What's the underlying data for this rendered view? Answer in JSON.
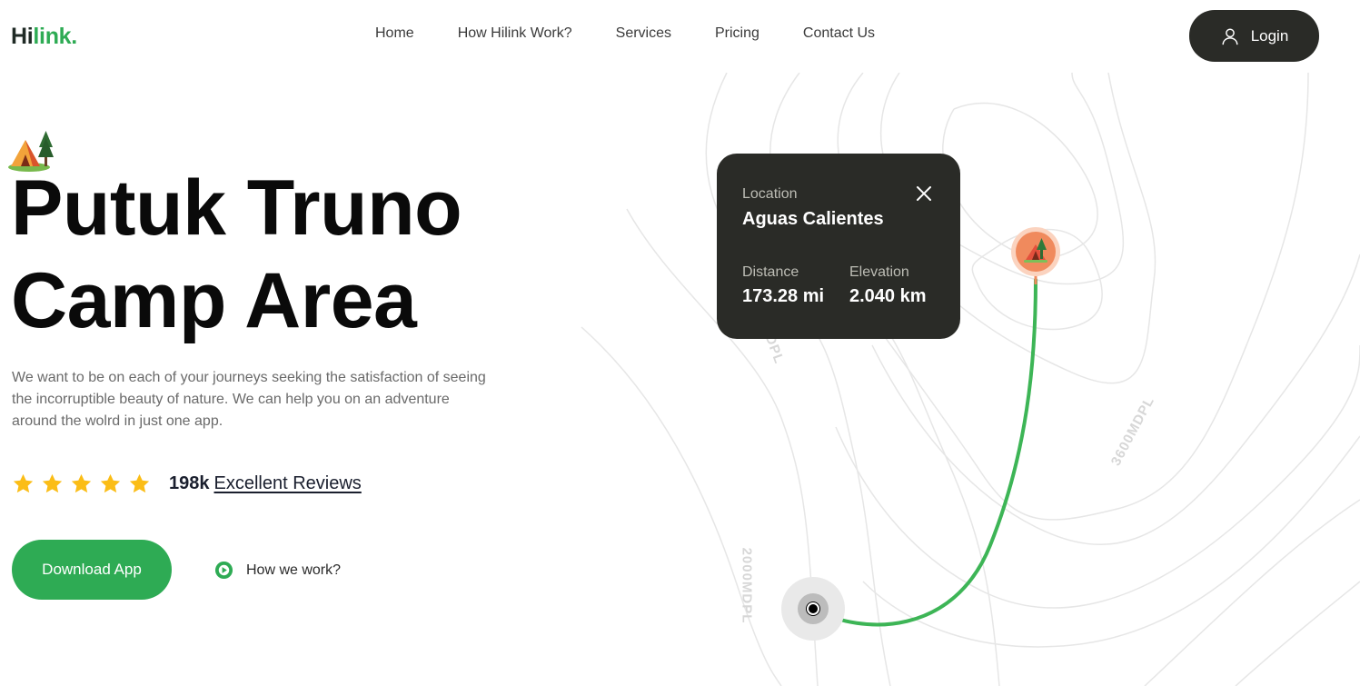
{
  "brand": {
    "logo_part1": "Hi",
    "logo_part2": "link."
  },
  "nav": {
    "items": [
      {
        "label": "Home"
      },
      {
        "label": "How Hilink Work?"
      },
      {
        "label": "Services"
      },
      {
        "label": "Pricing"
      },
      {
        "label": "Contact Us"
      }
    ],
    "login_label": "Login"
  },
  "hero": {
    "title_line1": "Putuk Truno",
    "title_line2": "Camp Area",
    "description": "We want to be on each of your journeys seeking the satisfaction of seeing the incorruptible beauty of nature. We can help you on an adventure around the wolrd in just one app.",
    "rating_stars": 5,
    "review_count": "198k",
    "review_link": "Excellent Reviews",
    "download_label": "Download App",
    "how_label": "How we work?"
  },
  "map": {
    "contour_labels": [
      "2000MDPL",
      "3600MDPL",
      "DPL"
    ],
    "card": {
      "location_label": "Location",
      "location_value": "Aguas Calientes",
      "distance_label": "Distance",
      "distance_value": "173.28 mi",
      "elevation_label": "Elevation",
      "elevation_value": "2.040 km"
    },
    "route_color": "#3db556",
    "pin_color": "#f08a5d"
  },
  "colors": {
    "brand_green": "#2eab54",
    "dark": "#2a2b27",
    "star": "#fbbd16"
  }
}
